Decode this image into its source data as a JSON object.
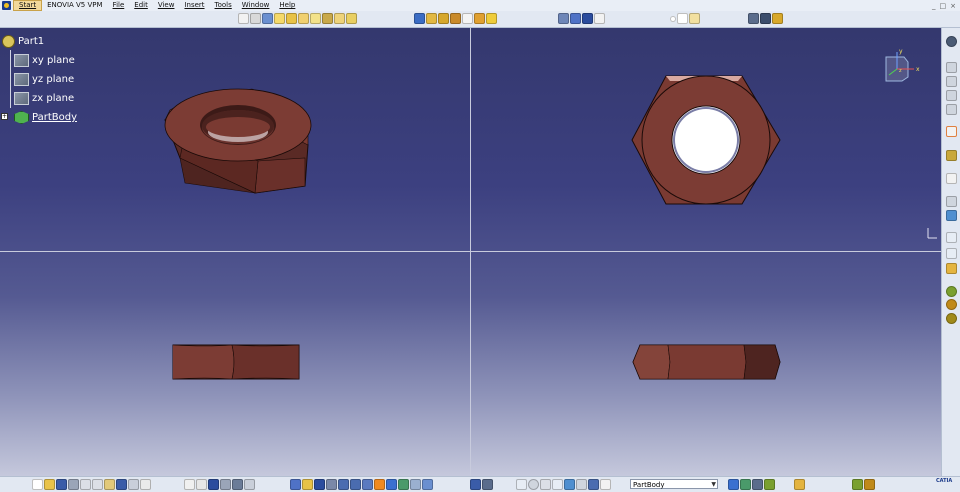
{
  "menubar": {
    "items": [
      "Start",
      "ENOVIA V5 VPM",
      "File",
      "Edit",
      "View",
      "Insert",
      "Tools",
      "Window",
      "Help"
    ],
    "window_controls": [
      "_",
      "□",
      "×"
    ]
  },
  "tree": {
    "root": "Part1",
    "children": [
      "xy plane",
      "yz plane",
      "zx plane",
      "PartBody"
    ]
  },
  "compass": {
    "x_label": "x",
    "y_label": "y",
    "z_label": "z"
  },
  "bottombar": {
    "current_body": "PartBody"
  },
  "brand": "CATIA",
  "colors": {
    "nut_face": "#7a3a32",
    "nut_dark": "#4e2420",
    "viewport_top": "#34386e",
    "viewport_bottom": "#c5c8dc"
  },
  "toolbar_icons": {
    "top": [
      "sketch-icon",
      "pad-icon",
      "pocket-icon",
      "shaft-icon",
      "hole-icon",
      "rib-icon",
      "fillet-icon",
      "chamfer-icon",
      "draft-icon",
      "shell-icon",
      "boolean-icon",
      "pattern-icon",
      "view-iso-icon",
      "snap-icon",
      "plane-icon"
    ],
    "right": [
      "select-icon",
      "sketcher-icon",
      "analysis-icon",
      "measure-icon",
      "apply-material-icon"
    ],
    "bottom": [
      "new-icon",
      "open-icon",
      "save-icon",
      "print-icon",
      "cut-icon",
      "copy-icon",
      "paste-icon",
      "undo-icon",
      "redo-icon",
      "help-icon",
      "formula-icon",
      "pan-icon",
      "rotate-icon",
      "zoom-in-icon",
      "zoom-out-icon",
      "fit-all-icon",
      "render-style-icon",
      "hide-show-icon",
      "swap-icon"
    ]
  }
}
